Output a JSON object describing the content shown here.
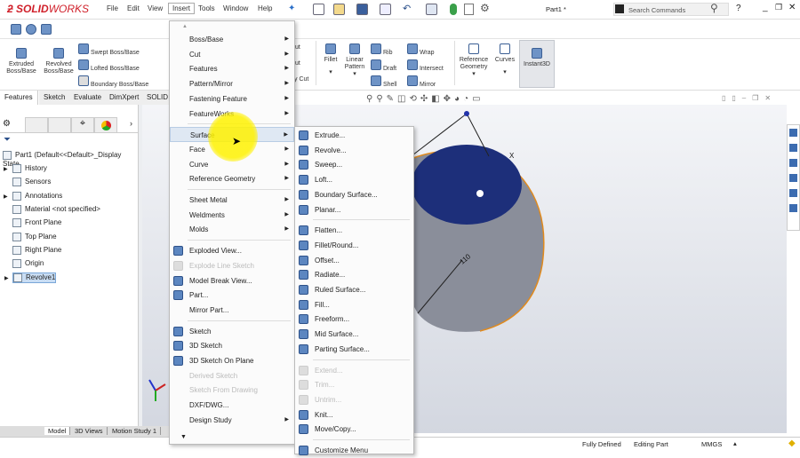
{
  "app": {
    "logo": "SOLIDWORKS",
    "doc_title": "Part1 *",
    "search_placeholder": "Search Commands"
  },
  "menubar": [
    "File",
    "Edit",
    "View",
    "Insert",
    "Tools",
    "Window",
    "Help"
  ],
  "ribbon": {
    "extruded": "Extruded Boss/Base",
    "revolved": "Revolved Boss/Base",
    "swept": "Swept Boss/Base",
    "lofted": "Lofted Boss/Base",
    "boundary": "Boundary Boss/Base",
    "cut1": "ut",
    "cut2": "ut",
    "cut3": "y Cut",
    "fillet": "Fillet",
    "linear": "Linear Pattern",
    "rib": "Rib",
    "draft": "Draft",
    "shell": "Shell",
    "wrap": "Wrap",
    "intersect": "Intersect",
    "mirror": "Mirror",
    "refgeo": "Reference Geometry",
    "curves": "Curves",
    "instant3d": "Instant3D"
  },
  "tabs": [
    "Features",
    "Sketch",
    "Evaluate",
    "DimXpert",
    "SOLID"
  ],
  "tree": {
    "root": "Part1  (Default<<Default>_Display State",
    "items": [
      "History",
      "Sensors",
      "Annotations",
      "Material <not specified>",
      "Front Plane",
      "Top Plane",
      "Right Plane",
      "Origin",
      "Revolve1"
    ]
  },
  "insert_menu": [
    {
      "label": "Boss/Base",
      "sub": true
    },
    {
      "label": "Cut",
      "sub": true
    },
    {
      "label": "Features",
      "sub": true
    },
    {
      "label": "Pattern/Mirror",
      "sub": true
    },
    {
      "label": "Fastening Feature",
      "sub": true
    },
    {
      "label": "FeatureWorks",
      "sub": true
    },
    {
      "sep": true
    },
    {
      "label": "Surface",
      "sub": true,
      "hl": true
    },
    {
      "label": "Face",
      "sub": true
    },
    {
      "label": "Curve",
      "sub": true
    },
    {
      "label": "Reference Geometry",
      "sub": true
    },
    {
      "sep": true
    },
    {
      "label": "Sheet Metal",
      "sub": true
    },
    {
      "label": "Weldments",
      "sub": true
    },
    {
      "label": "Molds",
      "sub": true
    },
    {
      "sep": true
    },
    {
      "label": "Exploded View...",
      "icon": true
    },
    {
      "label": "Explode Line Sketch",
      "icon": true,
      "dis": true
    },
    {
      "label": "Model Break View...",
      "icon": true
    },
    {
      "label": "Part...",
      "icon": true
    },
    {
      "label": "Mirror Part..."
    },
    {
      "sep": true
    },
    {
      "label": "Sketch",
      "icon": true
    },
    {
      "label": "3D Sketch",
      "icon": true
    },
    {
      "label": "3D Sketch On Plane",
      "icon": true
    },
    {
      "label": "Derived Sketch",
      "dis": true
    },
    {
      "label": "Sketch From Drawing",
      "dis": true
    },
    {
      "label": "DXF/DWG..."
    },
    {
      "label": "Design Study",
      "sub": true
    }
  ],
  "surface_menu": [
    {
      "label": "Extrude..."
    },
    {
      "label": "Revolve..."
    },
    {
      "label": "Sweep..."
    },
    {
      "label": "Loft..."
    },
    {
      "label": "Boundary Surface..."
    },
    {
      "label": "Planar..."
    },
    {
      "sep": true
    },
    {
      "label": "Flatten..."
    },
    {
      "label": "Fillet/Round..."
    },
    {
      "label": "Offset..."
    },
    {
      "label": "Radiate..."
    },
    {
      "label": "Ruled Surface..."
    },
    {
      "label": "Fill..."
    },
    {
      "label": "Freeform..."
    },
    {
      "label": "Mid Surface..."
    },
    {
      "label": "Parting Surface..."
    },
    {
      "sep": true
    },
    {
      "label": "Extend...",
      "dis": true
    },
    {
      "label": "Trim...",
      "dis": true
    },
    {
      "label": "Untrim...",
      "dis": true
    },
    {
      "label": "Knit..."
    },
    {
      "label": "Move/Copy..."
    },
    {
      "sep": true
    },
    {
      "label": "Customize Menu"
    }
  ],
  "bottom_tabs": [
    "Model",
    "3D Views",
    "Motion Study 1"
  ],
  "status": {
    "defined": "Fully Defined",
    "mode": "Editing Part",
    "units": "MMGS"
  },
  "viewport": {
    "dimension": "110",
    "axis_label": "X"
  }
}
